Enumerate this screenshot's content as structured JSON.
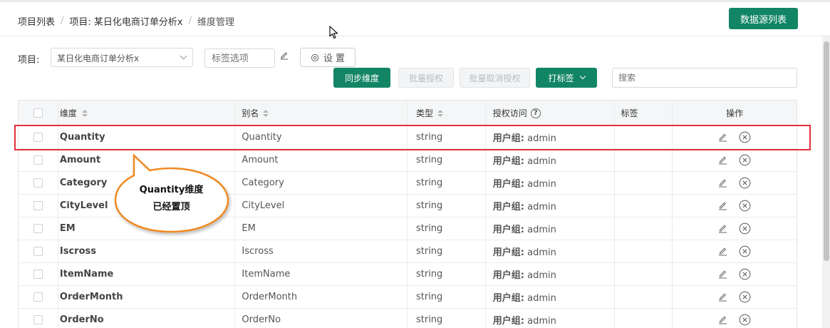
{
  "breadcrumb": {
    "items": [
      "项目列表",
      "项目: 某日化电商订单分析x",
      "维度管理"
    ],
    "separator": "/"
  },
  "header": {
    "datasource_button": "数据源列表"
  },
  "filters": {
    "project_label": "项目:",
    "project_value": "某日化电商订单分析x",
    "tag_placeholder": "标签选项",
    "settings_label": "设 置"
  },
  "actions": {
    "sync": "同步维度",
    "batch_auth": "批量授权",
    "batch_unauth": "批量取消授权",
    "tag": "打标签",
    "search_placeholder": "搜索"
  },
  "table": {
    "headers": {
      "dimension": "维度",
      "alias": "别名",
      "type": "类型",
      "auth": "授权访问",
      "tags": "标签",
      "ops": "操作"
    },
    "rows": [
      {
        "dimension": "Quantity",
        "alias": "Quantity",
        "type": "string",
        "auth_label": "用户组:",
        "auth_value": "admin"
      },
      {
        "dimension": "Amount",
        "alias": "Amount",
        "type": "string",
        "auth_label": "用户组:",
        "auth_value": "admin"
      },
      {
        "dimension": "Category",
        "alias": "Category",
        "type": "string",
        "auth_label": "用户组:",
        "auth_value": "admin"
      },
      {
        "dimension": "CityLevel",
        "alias": "CityLevel",
        "type": "string",
        "auth_label": "用户组:",
        "auth_value": "admin"
      },
      {
        "dimension": "EM",
        "alias": "EM",
        "type": "string",
        "auth_label": "用户组:",
        "auth_value": "admin"
      },
      {
        "dimension": "Iscross",
        "alias": "Iscross",
        "type": "string",
        "auth_label": "用户组:",
        "auth_value": "admin"
      },
      {
        "dimension": "ItemName",
        "alias": "ItemName",
        "type": "string",
        "auth_label": "用户组:",
        "auth_value": "admin"
      },
      {
        "dimension": "OrderMonth",
        "alias": "OrderMonth",
        "type": "string",
        "auth_label": "用户组:",
        "auth_value": "admin"
      },
      {
        "dimension": "OrderNo",
        "alias": "OrderNo",
        "type": "string",
        "auth_label": "用户组:",
        "auth_value": "admin"
      }
    ]
  },
  "annotation": {
    "callout_line1": "Quantity维度",
    "callout_line2": "已经置顶"
  },
  "icons": {
    "edit": "pencil-icon",
    "delete": "circle-x-icon",
    "settings": "gear-icon",
    "help": "question-circle-icon",
    "sort": "sort-icon",
    "dropdown": "chevron-down-icon",
    "cursor": "mouse-cursor-icon"
  },
  "colors": {
    "primary": "#128564",
    "highlight_border": "#e2303a",
    "callout_border": "#f08a24"
  }
}
